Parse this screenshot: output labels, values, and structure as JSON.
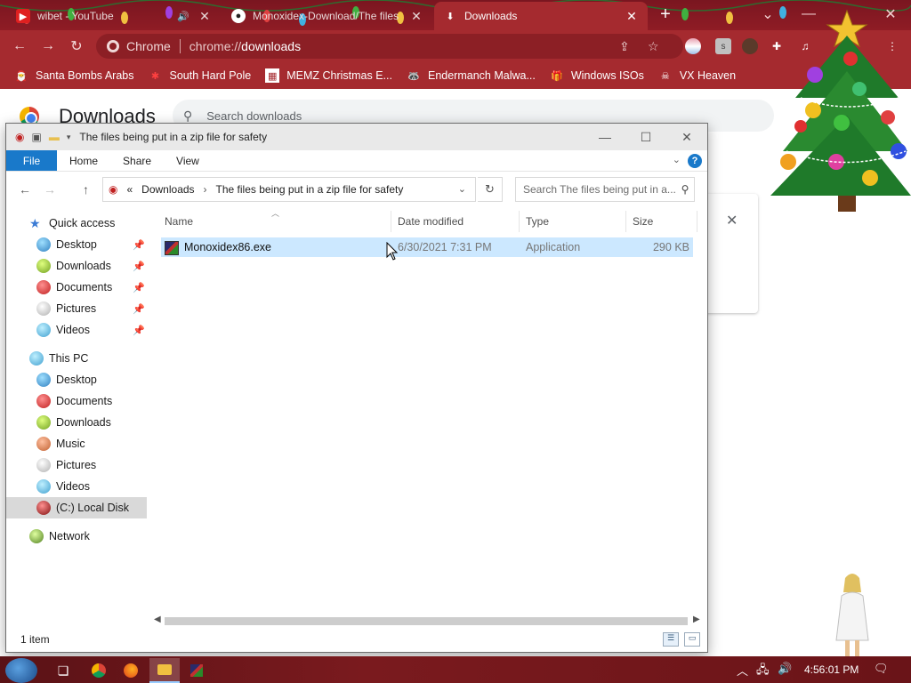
{
  "chrome": {
    "tabs": [
      {
        "title": "wibet - YouTube",
        "icon": "youtube-icon"
      },
      {
        "title": "Monoxidex-Download/The files",
        "icon": "github-icon"
      },
      {
        "title": "Downloads",
        "icon": "download-icon",
        "active": true
      }
    ],
    "new_tab": "+",
    "omnibox": {
      "chip": "Chrome",
      "url_prefix": "chrome://",
      "url_host": "downloads"
    },
    "bookmarks": [
      {
        "label": "Santa Bombs Arabs",
        "icon": "santa-icon"
      },
      {
        "label": "South Hard Pole",
        "icon": "snowflake-icon"
      },
      {
        "label": "MEMZ Christmas E...",
        "icon": "page-icon"
      },
      {
        "label": "Endermanch Malwa...",
        "icon": "raccoon-icon"
      },
      {
        "label": "Windows ISOs",
        "icon": "gift-icon"
      },
      {
        "label": "VX Heaven",
        "icon": "skull-icon"
      }
    ]
  },
  "downloads_page": {
    "title": "Downloads",
    "search_placeholder": "Search downloads"
  },
  "explorer": {
    "window_title": "The files being put in a zip file for safety",
    "ribbon_tabs": [
      "File",
      "Home",
      "Share",
      "View"
    ],
    "address": {
      "overflow": "«",
      "crumbs": [
        "Downloads",
        "The files being put in a zip file for safety"
      ]
    },
    "search_placeholder": "Search The files being put in a...",
    "nav_pane": {
      "quick_access": "Quick access",
      "quick_items": [
        "Desktop",
        "Downloads",
        "Documents",
        "Pictures",
        "Videos"
      ],
      "this_pc": "This PC",
      "pc_items": [
        "Desktop",
        "Documents",
        "Downloads",
        "Music",
        "Pictures",
        "Videos",
        "(C:) Local Disk"
      ],
      "network": "Network"
    },
    "columns": [
      "Name",
      "Date modified",
      "Type",
      "Size"
    ],
    "files": [
      {
        "name": "Monoxidex86.exe",
        "date": "6/30/2021 7:31 PM",
        "type": "Application",
        "size": "290 KB"
      }
    ],
    "status": "1 item"
  },
  "taskbar": {
    "clock": "4:56:01 PM"
  },
  "colors": {
    "chrome_theme": "#a52a2f",
    "tab_strip": "#8f1c25",
    "file_tab": "#1979ca",
    "selection": "#cce8ff",
    "taskbar": "#6a1418"
  }
}
